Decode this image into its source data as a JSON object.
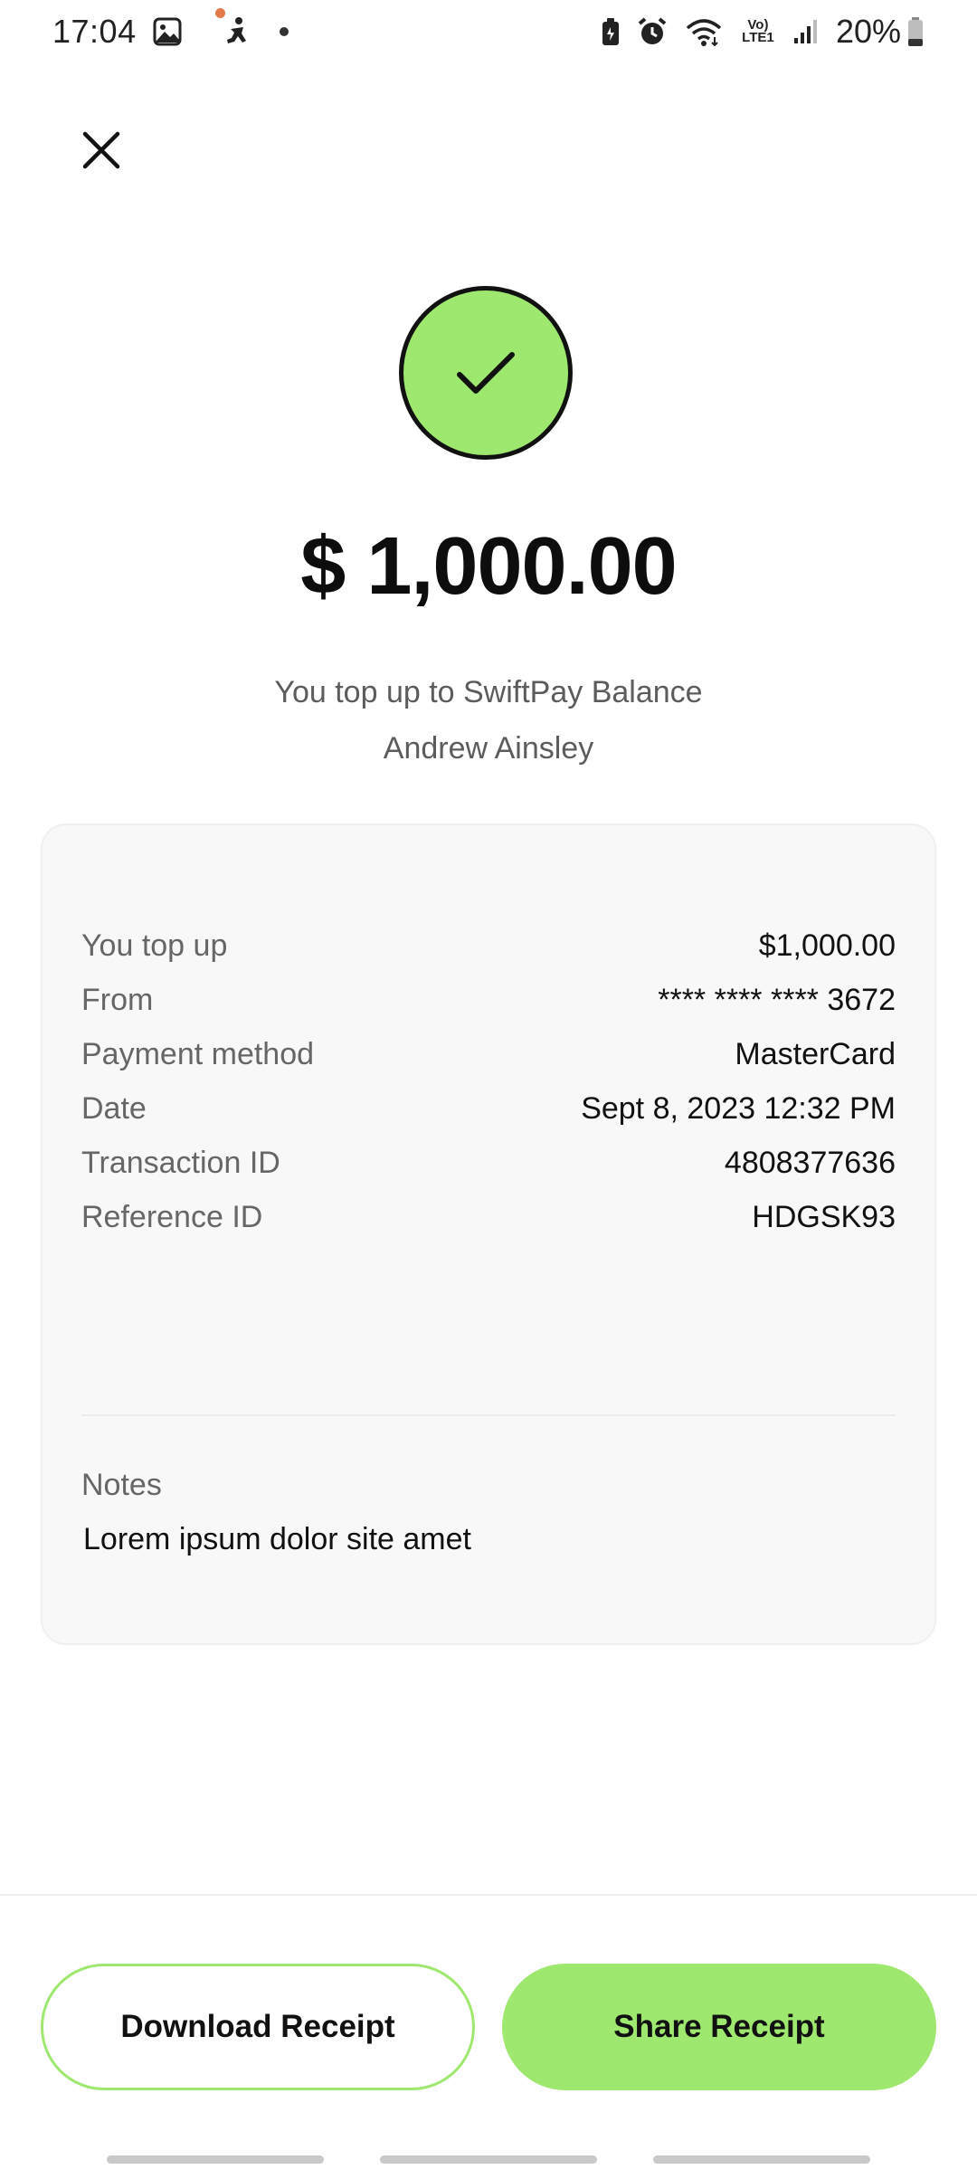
{
  "status_bar": {
    "time": "17:04",
    "battery": "20%",
    "icons": [
      "image-icon",
      "notification-dot-icon",
      "accessibility-icon",
      "dot-icon",
      "battery-saver-icon",
      "alarm-icon",
      "wifi-icon",
      "volte-icon",
      "signal-icon",
      "battery-icon"
    ],
    "network_label": "Vo) LTE1"
  },
  "header": {
    "close_icon": "close-icon"
  },
  "success": {
    "icon": "check-icon",
    "color": "#9fe870",
    "amount": "$ 1,000.00",
    "line1": "You top up to SwiftPay Balance",
    "line2": "Andrew Ainsley"
  },
  "details": {
    "rows": [
      {
        "label": "You top up",
        "value": "$1,000.00"
      },
      {
        "label": "From",
        "value": "**** **** **** 3672"
      },
      {
        "label": "Payment method",
        "value": "MasterCard"
      },
      {
        "label": "Date",
        "value": "Sept 8, 2023 12:32 PM"
      },
      {
        "label": "Transaction ID",
        "value": "4808377636"
      },
      {
        "label": "Reference ID",
        "value": "HDGSK93"
      }
    ],
    "notes_label": "Notes",
    "notes_value": "Lorem ipsum dolor site amet"
  },
  "actions": {
    "download_label": "Download Receipt",
    "share_label": "Share Receipt"
  }
}
